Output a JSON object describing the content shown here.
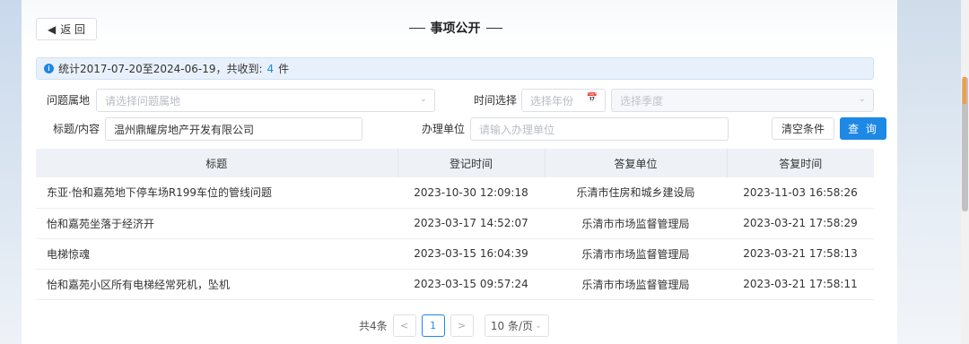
{
  "header": {
    "back_label": "返 回",
    "title": "事项公开"
  },
  "info": {
    "prefix": "统计2017-07-20至2024-06-19，共收到: ",
    "count": "4",
    "suffix": " 件"
  },
  "filters": {
    "category_label": "问题属地",
    "category_placeholder": "请选择问题属地",
    "time_label": "时间选择",
    "year_placeholder": "选择年份",
    "quarter_placeholder": "选择季度",
    "keyword_label": "标题/内容",
    "keyword_value": "温州鼎耀房地产开发有限公司",
    "unit_label": "办理单位",
    "unit_placeholder": "请输入办理单位",
    "clear_label": "清空条件",
    "query_label": "查 询"
  },
  "table": {
    "columns": [
      "标题",
      "登记时间",
      "答复单位",
      "答复时间"
    ],
    "rows": [
      [
        "东亚·怡和嘉苑地下停车场R199车位的管线问题",
        "2023-10-30 12:09:18",
        "乐清市住房和城乡建设局",
        "2023-11-03 16:58:26"
      ],
      [
        "怡和嘉苑坐落于经济开",
        "2023-03-17 14:52:07",
        "乐清市市场监督管理局",
        "2023-03-21 17:58:29"
      ],
      [
        "电梯惊魂",
        "2023-03-15 16:04:39",
        "乐清市市场监督管理局",
        "2023-03-21 17:58:13"
      ],
      [
        "怡和嘉苑小区所有电梯经常死机，坠机",
        "2023-03-15 09:57:24",
        "乐清市市场监督管理局",
        "2023-03-21 17:58:11"
      ]
    ]
  },
  "pager": {
    "total": "共4条",
    "current": "1",
    "page_size": "10 条/页"
  },
  "colors": {
    "accent": "#1e88e5"
  }
}
